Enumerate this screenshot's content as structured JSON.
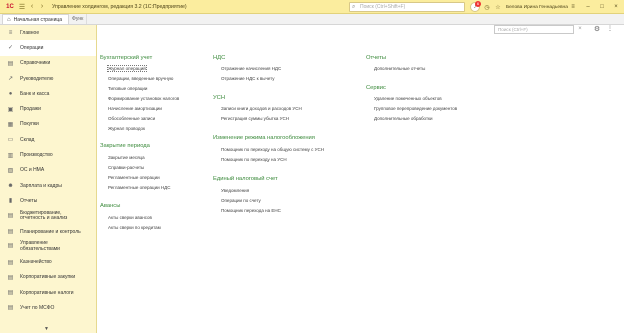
{
  "titlebar": {
    "logo": "1С",
    "title": "Управление холдингом, редакция 3.2  (1С:Предприятие)",
    "search_placeholder": "Поиск (Ctrl+Shift+F)",
    "notifications_count": "6",
    "user": "Белова Ирина Геннадьевна"
  },
  "tabs": {
    "home": "Начальная страница",
    "second": "Функ"
  },
  "sidebar": {
    "items": [
      {
        "label": "Главное",
        "icon": "≡"
      },
      {
        "label": "Операции",
        "icon": "✓"
      },
      {
        "label": "Справочники",
        "icon": "▤"
      },
      {
        "label": "Руководителю",
        "icon": "↗"
      },
      {
        "label": "Банк и касса",
        "icon": "●"
      },
      {
        "label": "Продажи",
        "icon": "▣"
      },
      {
        "label": "Покупки",
        "icon": "▦"
      },
      {
        "label": "Склад",
        "icon": "▭"
      },
      {
        "label": "Производство",
        "icon": "▥"
      },
      {
        "label": "ОС и НМА",
        "icon": "▧"
      },
      {
        "label": "Зарплата и кадры",
        "icon": "☻"
      },
      {
        "label": "Отчеты",
        "icon": "▮"
      },
      {
        "label1": "Бюджетирование,",
        "label2": "отчетность и анализ",
        "icon": "▤"
      },
      {
        "label": "Планирование и контроль",
        "icon": "▤"
      },
      {
        "label1": "Управление",
        "label2": "обязательствами",
        "icon": "▤"
      },
      {
        "label": "Казначейство",
        "icon": "▤"
      },
      {
        "label": "Корпоративные закупки",
        "icon": "▤"
      },
      {
        "label": "Корпоративные налоги",
        "icon": "▤"
      },
      {
        "label": "Учет по МСФО",
        "icon": "▤"
      }
    ],
    "scroll_down": "▼"
  },
  "main": {
    "search_placeholder": "Поиск (Ctrl+F)",
    "clear": "×",
    "settings_icon": "⚙",
    "more": "⋮",
    "sections": {
      "buh": {
        "title": "Бухгалтерский учет",
        "links": [
          "Журнал операций",
          "Операции, введенные вручную",
          "Типовые операции",
          "Формирование установок налогов",
          "Начисление амортизации",
          "Обособленные записи",
          "Журнал проводок"
        ]
      },
      "close": {
        "title": "Закрытие периода",
        "links": [
          "Закрытие месяца",
          "Справки-расчеты",
          "Регламентные операции",
          "Регламентные операции НДС"
        ]
      },
      "avans": {
        "title": "Авансы",
        "links": [
          "Акты сверки авансов",
          "Акты сверки по кредитам"
        ]
      },
      "nds": {
        "title": "НДС",
        "links": [
          "Отражение начисления НДС",
          "Отражение НДС к вычету"
        ]
      },
      "usn": {
        "title": "УСН",
        "links": [
          "Записи книги доходов и расходов УСН",
          "Регистрация суммы убытка УСН"
        ]
      },
      "regime": {
        "title": "Изменение режима налогообложения",
        "links": [
          "Помощник по переходу на общую систему с УСН",
          "Помощник по переходу на УСН"
        ]
      },
      "ens": {
        "title": "Единый налоговый счет",
        "links": [
          "Уведомления",
          "Операции по счету",
          "Помощник перехода на ЕНС"
        ]
      },
      "reports": {
        "title": "Отчеты",
        "links": [
          "Дополнительные отчеты"
        ]
      },
      "service": {
        "title": "Сервис",
        "links": [
          "Удаление помеченных объектов",
          "Групповое перепроведение документов",
          "Дополнительные обработки"
        ]
      }
    }
  }
}
